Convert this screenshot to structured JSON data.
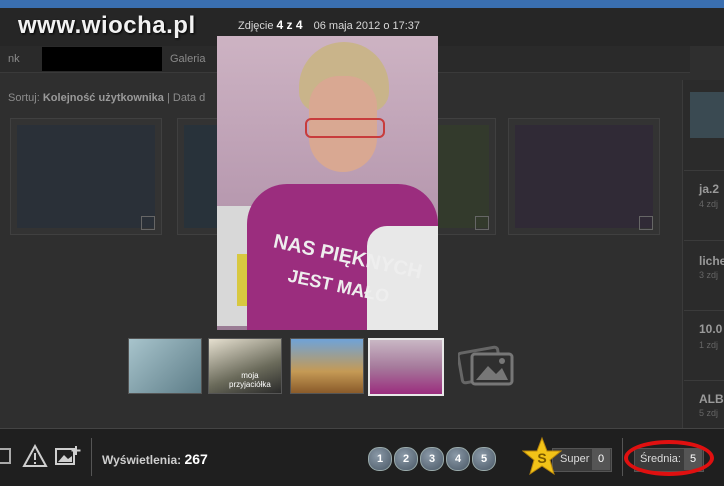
{
  "header": {
    "watermark": "www.wiocha.pl",
    "photo_label": "Zdjęcie",
    "photo_counter": "4 z 4",
    "photo_date": "06 maja 2012 o 17:37"
  },
  "nav": {
    "crumb_nk": "nk",
    "crumb_gallery": "Galeria"
  },
  "sort": {
    "label": "Sortuj:",
    "active": "Kolejność użytkownika",
    "sep": "|",
    "other": "Data d"
  },
  "right_panel": {
    "items": [
      {
        "title": "ja.2",
        "sub": "4 zdj"
      },
      {
        "title": "liche",
        "sub": "3 zdj"
      },
      {
        "title": "10.0",
        "sub": "1 zdj"
      },
      {
        "title": "ALBU",
        "sub": "5 zdj"
      }
    ]
  },
  "main_photo": {
    "shirt_line1": "NAS PIĘKNYCH",
    "shirt_line2": "JEST MAŁO"
  },
  "filmstrip": {
    "thumb2_caption_line1": "moja",
    "thumb2_caption_line2": "przyjaciółka",
    "active_index": 4
  },
  "bottom": {
    "views_label": "Wyświetlenia:",
    "views_value": "267",
    "ratings": [
      "1",
      "2",
      "3",
      "4",
      "5"
    ],
    "super_label": "Super",
    "super_count": "0",
    "average_label": "Średnia:",
    "average_value": "5"
  },
  "colors": {
    "highlight_ellipse": "#e01010",
    "top_strip": "#3a6fb0",
    "star": "#f2c318"
  }
}
